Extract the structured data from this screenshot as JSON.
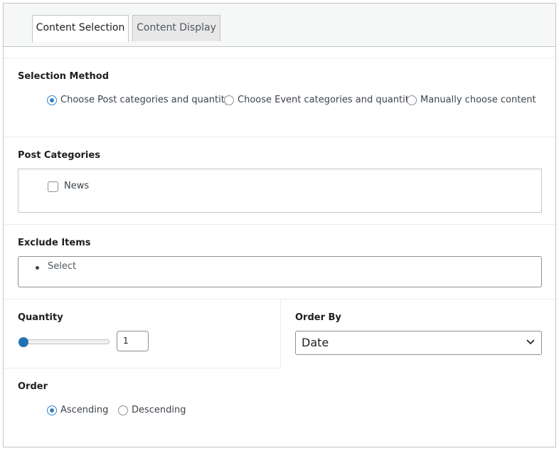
{
  "tabs": [
    {
      "label": "Content Selection",
      "active": true
    },
    {
      "label": "Content Display",
      "active": false
    }
  ],
  "selection_method": {
    "title": "Selection Method",
    "options": [
      {
        "label": "Choose Post categories and quantity",
        "checked": true
      },
      {
        "label": "Choose Event categories and quantity",
        "checked": false
      },
      {
        "label": "Manually choose content",
        "checked": false
      }
    ]
  },
  "post_categories": {
    "title": "Post Categories",
    "items": [
      {
        "label": "News",
        "checked": false
      }
    ]
  },
  "exclude_items": {
    "title": "Exclude Items",
    "placeholder": "Select"
  },
  "quantity": {
    "title": "Quantity",
    "value": "1",
    "slider_fraction": 0
  },
  "order_by": {
    "title": "Order By",
    "selected": "Date"
  },
  "order": {
    "title": "Order",
    "options": [
      {
        "label": "Ascending",
        "checked": true
      },
      {
        "label": "Descending",
        "checked": false
      }
    ]
  },
  "colors": {
    "accent": "#3582c4",
    "slider": "#2271b1",
    "border": "#c3c4c7"
  },
  "icons": {
    "select_arrow": "chevron-down-icon"
  }
}
